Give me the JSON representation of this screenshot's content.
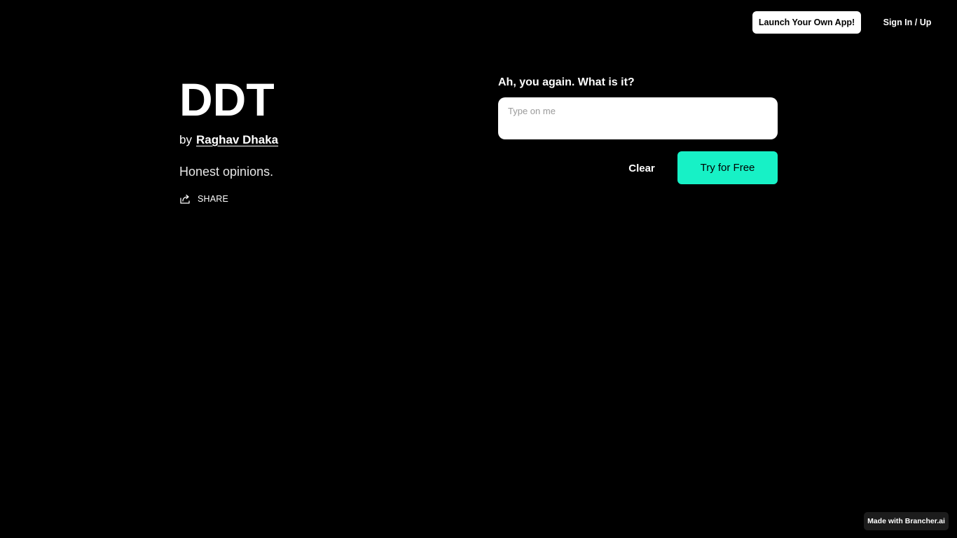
{
  "nav": {
    "launch_label": "Launch Your Own App!",
    "signin_label": "Sign In / Up"
  },
  "app": {
    "title": "DDT",
    "by_label": "by",
    "author": "Raghav Dhaka",
    "tagline": "Honest opinions.",
    "share_label": "SHARE",
    "share_icon": "share-icon"
  },
  "chat": {
    "prompt": "Ah, you again. What is it?",
    "input_value": "",
    "input_placeholder": "Type on me",
    "clear_label": "Clear",
    "try_label": "Try for Free"
  },
  "footer": {
    "made_with": "Made with Brancher.ai"
  },
  "colors": {
    "background": "#000000",
    "accent": "#17f1c6",
    "text": "#ffffff",
    "badge_bg": "#1c1c1c"
  }
}
